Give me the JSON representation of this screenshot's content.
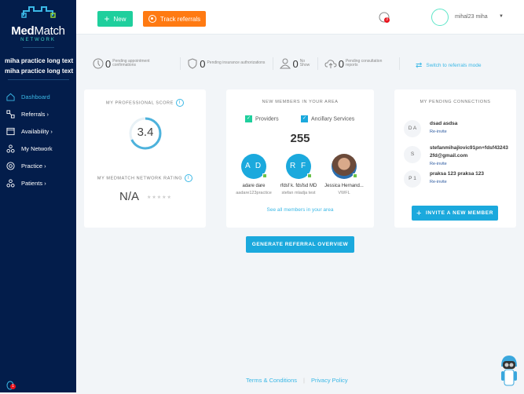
{
  "brand": {
    "name_bold": "Med",
    "name_light": "Match",
    "sub": "NETWORK"
  },
  "sidebar": {
    "practice": "miha practice long text miha practice long text",
    "items": [
      {
        "label": "Dashboard",
        "icon": "home-icon"
      },
      {
        "label": "Referrals",
        "icon": "referrals-icon"
      },
      {
        "label": "Availability",
        "icon": "calendar-icon"
      },
      {
        "label": "My Network",
        "icon": "network-icon"
      },
      {
        "label": "Practice",
        "icon": "practice-icon"
      },
      {
        "label": "Patients",
        "icon": "patients-icon"
      }
    ],
    "bottom_badge": "1"
  },
  "header": {
    "new_label": "New",
    "track_label": "Track referrals",
    "notif_count": "3",
    "user_name": "mihal23 miha"
  },
  "stats": [
    {
      "value": "0",
      "label": "Pending appointment confirmations"
    },
    {
      "value": "0",
      "label": "Pending insurance authorizations"
    },
    {
      "value": "0",
      "label": "No Show"
    },
    {
      "value": "0",
      "label": "Pending consultation reports"
    }
  ],
  "switch_label": "Switch to referrals mode",
  "score": {
    "title": "MY PROFESSIONAL SCORE",
    "value": "3.4",
    "progress": 0.68,
    "rating_title": "MY MEDMATCH NETWORK RATING",
    "rating": "N/A",
    "stars": "★★★★★"
  },
  "members": {
    "title": "NEW MEMBERS IN YOUR AREA",
    "filter1": "Providers",
    "filter2": "Ancillary Services",
    "count": "255",
    "list": [
      {
        "initials": "A D",
        "name": "adare dare",
        "sub": "aadare123practice"
      },
      {
        "initials": "R F",
        "name": "rfdsf k. fdsfsd MD",
        "sub": "stefan mladja test"
      },
      {
        "initials": "",
        "name": "Jessica Hernand...",
        "sub": "VWFL"
      }
    ],
    "see_all": "See all members in your area"
  },
  "pending": {
    "title": "MY PENDING CONNECTIONS",
    "list": [
      {
        "initials": "D A",
        "name": "dsad asdsa",
        "action": "Re-invite"
      },
      {
        "initials": "S",
        "name": "stefanmihajlovic91pn+fdsf432432fd@gmail.com",
        "action": "Re-invite"
      },
      {
        "initials": "P 1",
        "name": "praksa 123 praksa 123",
        "action": "Re-invite"
      }
    ],
    "invite_label": "INVITE A NEW MEMBER"
  },
  "generate_label": "GENERATE REFERRAL OVERVIEW",
  "footer": {
    "terms": "Terms & Conditions",
    "sep": "|",
    "privacy": "Privacy Policy"
  }
}
